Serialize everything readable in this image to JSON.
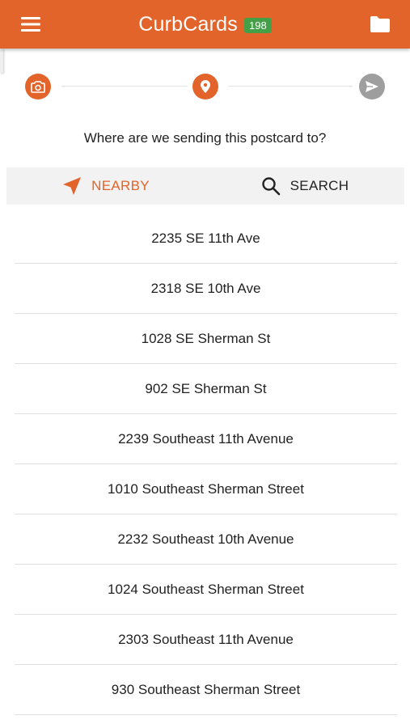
{
  "header": {
    "title": "CurbCards",
    "badge_count": "198",
    "brand_color": "#e2642b",
    "badge_color": "#43a047",
    "menu_icon": "hamburger-menu-icon",
    "folder_icon": "folder-icon"
  },
  "stepper": {
    "steps": [
      {
        "icon": "camera-icon",
        "state": "done"
      },
      {
        "icon": "location-pin-icon",
        "state": "current"
      },
      {
        "icon": "send-icon",
        "state": "upcoming"
      }
    ]
  },
  "prompt": "Where are we sending this postcard to?",
  "tabs": {
    "nearby_label": "NEARBY",
    "search_label": "SEARCH",
    "active": "nearby"
  },
  "addresses": [
    "2235 SE 11th Ave",
    "2318 SE 10th Ave",
    "1028 SE Sherman St",
    "902 SE Sherman St",
    "2239 Southeast 11th Avenue",
    "1010 Southeast Sherman Street",
    "2232 Southeast 10th Avenue",
    "1024 Southeast Sherman Street",
    "2303 Southeast 11th Avenue",
    "930 Southeast Sherman Street"
  ]
}
